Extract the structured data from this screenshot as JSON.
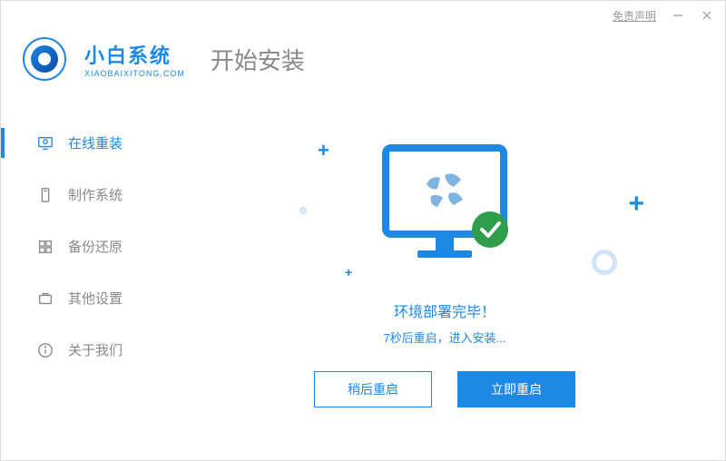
{
  "titlebar": {
    "disclaimer": "免责声明"
  },
  "brand": {
    "name": "小白系统",
    "sub": "XIAOBAIXITONG.COM"
  },
  "page_title": "开始安装",
  "sidebar": {
    "items": [
      {
        "label": "在线重装",
        "icon": "monitor-refresh-icon",
        "active": true
      },
      {
        "label": "制作系统",
        "icon": "usb-icon",
        "active": false
      },
      {
        "label": "备份还原",
        "icon": "grid-icon",
        "active": false
      },
      {
        "label": "其他设置",
        "icon": "briefcase-icon",
        "active": false
      },
      {
        "label": "关于我们",
        "icon": "info-icon",
        "active": false
      }
    ]
  },
  "main": {
    "status_title": "环境部署完毕！",
    "status_sub": "7秒后重启，进入安装...",
    "btn_later": "稍后重启",
    "btn_now": "立即重启"
  }
}
